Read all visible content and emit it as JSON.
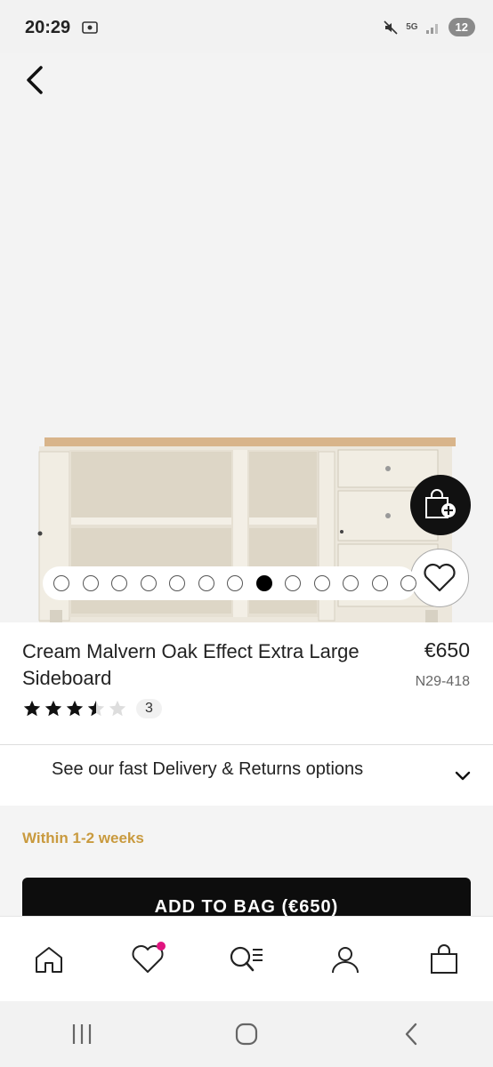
{
  "status_bar": {
    "time": "20:29",
    "network": "5G",
    "notification_count": "12"
  },
  "product": {
    "title": "Cream Malvern Oak Effect Extra Large Sideboard",
    "price": "€650",
    "code": "N29-418",
    "rating": 3.5,
    "rating_max": 5,
    "review_count": "3"
  },
  "carousel": {
    "total_dots": 13,
    "active_index": 7
  },
  "delivery": {
    "text": "See our fast Delivery & Returns options"
  },
  "availability": {
    "text": "Within 1-2 weeks"
  },
  "add_to_bag": {
    "label": "ADD TO BAG (€650)"
  },
  "bottom_nav": {
    "items": [
      {
        "name": "home",
        "icon": "home-icon"
      },
      {
        "name": "favourites",
        "icon": "heart-icon",
        "badge": true
      },
      {
        "name": "search",
        "icon": "search-icon"
      },
      {
        "name": "account",
        "icon": "user-icon"
      },
      {
        "name": "bag",
        "icon": "bag-icon"
      }
    ]
  },
  "colors": {
    "accent_gold": "#c99a3e",
    "badge_pink": "#e0147f",
    "button_black": "#0d0d0d"
  }
}
